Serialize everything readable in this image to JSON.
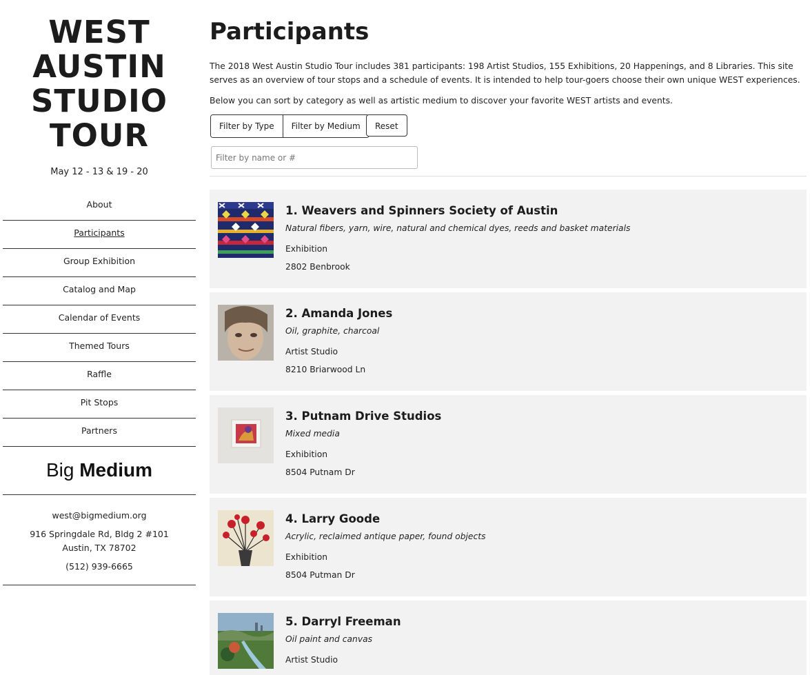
{
  "site": {
    "logo_lines": [
      "WEST",
      "AUSTIN",
      "STUDIO",
      "TOUR"
    ],
    "dates": "May 12 - 13 & 19 - 20"
  },
  "nav": {
    "items": [
      {
        "label": "About"
      },
      {
        "label": "Participants"
      },
      {
        "label": "Group Exhibition"
      },
      {
        "label": "Catalog and Map"
      },
      {
        "label": "Calendar of Events"
      },
      {
        "label": "Themed Tours"
      },
      {
        "label": "Raffle"
      },
      {
        "label": "Pit Stops"
      },
      {
        "label": "Partners"
      }
    ],
    "active_index": 1
  },
  "sponsor": {
    "word1": "Big",
    "word2": "Medium"
  },
  "contact": {
    "email": "west@bigmedium.org",
    "address_line1": "916 Springdale Rd, Bldg 2 #101",
    "address_line2": "Austin, TX 78702",
    "phone": "(512) 939-6665"
  },
  "main": {
    "title": "Participants",
    "intro": "The 2018 West Austin Studio Tour includes 381 participants: 198 Artist Studios, 155 Exhibitions, 20 Happenings, and 8 Libraries. This site serves as an overview of tour stops and a schedule of events. It is intended to help tour-goers choose their own unique WEST experiences.",
    "intro2": "Below you can sort by category as well as artistic medium to discover your favorite WEST artists and events.",
    "filter_type_label": "Filter by Type",
    "filter_medium_label": "Filter by Medium",
    "reset_label": "Reset",
    "search_placeholder": "Filter by name or #"
  },
  "participants": [
    {
      "title": "1. Weavers and Spinners Society of Austin",
      "medium": "Natural fibers, yarn, wire, natural and chemical dyes, reeds and basket materials",
      "type": "Exhibition",
      "address": "2802 Benbrook",
      "thumb": "woven-textile"
    },
    {
      "title": "2. Amanda Jones",
      "medium": "Oil, graphite, charcoal",
      "type": "Artist Studio",
      "address": "8210 Briarwood Ln",
      "thumb": "portrait-child"
    },
    {
      "title": "3. Putnam Drive Studios",
      "medium": "Mixed media",
      "type": "Exhibition",
      "address": "8504 Putnam Dr",
      "thumb": "framed-artwork"
    },
    {
      "title": "4. Larry Goode",
      "medium": "Acrylic, reclaimed antique paper, found objects",
      "type": "Exhibition",
      "address": "8504 Putman Dr",
      "thumb": "flowers-vase"
    },
    {
      "title": "5. Darryl Freeman",
      "medium": "Oil paint and canvas",
      "type": "Artist Studio",
      "address": "",
      "thumb": "landscape-painting"
    }
  ]
}
